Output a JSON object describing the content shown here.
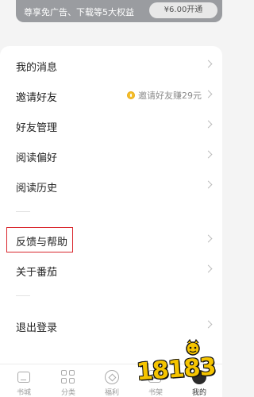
{
  "vip": {
    "text": "尊享免广告、下载等5大权益",
    "button_label": "¥6.00开通"
  },
  "menu": {
    "items": [
      {
        "label": "我的消息"
      },
      {
        "label": "邀请好友",
        "hint": "邀请好友赚29元"
      },
      {
        "label": "好友管理"
      },
      {
        "label": "阅读偏好"
      },
      {
        "label": "阅读历史"
      },
      {
        "label": "反馈与帮助"
      },
      {
        "label": "关于番茄"
      },
      {
        "label": "退出登录"
      }
    ]
  },
  "bottom_nav": {
    "items": [
      {
        "label": "书城",
        "icon": "home-icon"
      },
      {
        "label": "分类",
        "icon": "grid-icon"
      },
      {
        "label": "福利",
        "icon": "compass-icon"
      },
      {
        "label": "书架",
        "icon": "shelf-icon"
      },
      {
        "label": "我的",
        "icon": "user-icon",
        "active": true
      }
    ]
  },
  "watermark": {
    "text": "18183"
  },
  "colors": {
    "highlight": "#d9262c",
    "vip_strip": "#9a9ca0",
    "watermark": "#f5c400"
  }
}
